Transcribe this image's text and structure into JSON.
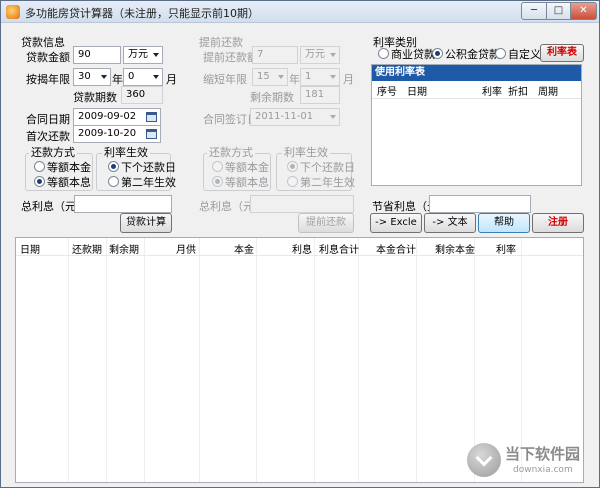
{
  "window": {
    "title": "多功能房贷计算器（未注册，只能显示前10期）",
    "minimize": "─",
    "maximize": "□",
    "close": "✕"
  },
  "loan": {
    "section_title": "贷款信息",
    "amount_label": "贷款金额",
    "amount_value": "90",
    "amount_unit": "万元",
    "years_label": "按揭年限",
    "years_value": "30",
    "year_unit": "年",
    "months_value": "0",
    "month_unit": "月",
    "periods_label": "贷款期数",
    "periods_value": "360",
    "contract_date_label": "合同日期",
    "contract_date_value": "2009-09-02",
    "first_payment_label": "首次还款",
    "first_payment_value": "2009-10-20",
    "repay_method": {
      "title": "还款方式",
      "opt1": "等额本金",
      "opt2": "等额本息",
      "selected": "opt2"
    },
    "rate_effect": {
      "title": "利率生效",
      "opt1": "下个还款日",
      "opt2": "第二年生效",
      "selected": "opt1"
    },
    "total_interest_label": "总利息（元）",
    "total_interest_value": "",
    "calc_button": "贷款计算"
  },
  "prepay": {
    "section_title": "提前还款",
    "amount_label": "提前还款额",
    "amount_value": "7",
    "amount_unit": "万元",
    "shorten_label": "缩短年限",
    "shorten_years": "15",
    "year_unit": "年",
    "shorten_months": "1",
    "month_unit": "月",
    "remain_label": "剩余期数",
    "remain_value": "181",
    "sign_date_label": "合同签订日",
    "sign_date_value": "2011-11-01",
    "repay_method": {
      "title": "还款方式",
      "opt1": "等额本金",
      "opt2": "等额本息",
      "selected": "opt2"
    },
    "rate_effect": {
      "title": "利率生效",
      "opt1": "下个还款日",
      "opt2": "第二年生效",
      "selected": "opt1"
    },
    "total_interest_label": "总利息（元）",
    "total_interest_value": "",
    "button": "提前还款"
  },
  "rate": {
    "section_title": "利率类别",
    "opt1": "商业贷款",
    "opt2": "公积金贷款",
    "opt3": "自定义",
    "selected": "opt2",
    "table_button": "利率表",
    "table_caption": "使用利率表",
    "columns": [
      "序号",
      "日期",
      "利率",
      "折扣",
      "周期"
    ]
  },
  "savings": {
    "label": "节省利息（元）",
    "value": ""
  },
  "actions": {
    "excel": "-> Excle",
    "text": "-> 文本",
    "help": "帮助",
    "register": "注册"
  },
  "result_grid": {
    "columns": [
      "日期",
      "还款期",
      "剩余期",
      "月供",
      "本金",
      "利息",
      "利息合计",
      "本金合计",
      "剩余本金",
      "利率"
    ]
  },
  "watermark": {
    "name": "当下软件园",
    "url": "downxia.com"
  },
  "colors": {
    "accent": "#1e5aa8",
    "warning": "#d40000"
  }
}
